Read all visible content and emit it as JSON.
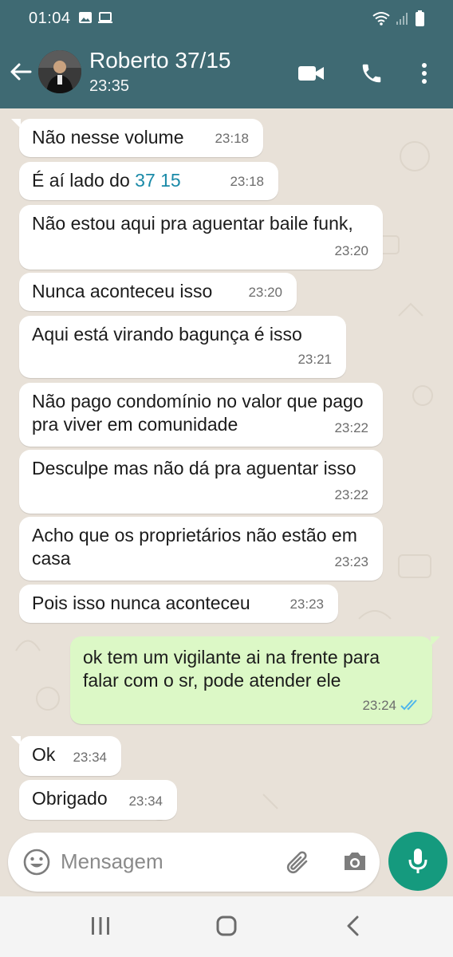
{
  "status_bar": {
    "time": "01:04"
  },
  "header": {
    "name": "Roberto 37/15",
    "status": "23:35"
  },
  "messages": [
    {
      "dir": "in",
      "text": "Não nesse volume",
      "time": "23:18"
    },
    {
      "dir": "in",
      "text_pre": "É aí lado do ",
      "text_link": "37 15",
      "time": "23:18"
    },
    {
      "dir": "in",
      "text": "Não  estou aqui pra aguentar baile funk,",
      "time": "23:20"
    },
    {
      "dir": "in",
      "text": "Nunca aconteceu isso",
      "time": "23:20"
    },
    {
      "dir": "in",
      "text": "Aqui está virando bagunça  é  isso",
      "time": "23:21"
    },
    {
      "dir": "in",
      "text": "Não pago condomínio no valor que pago pra viver em comunidade",
      "time": "23:22"
    },
    {
      "dir": "in",
      "text": "Desculpe mas não dá pra aguentar isso",
      "time": "23:22"
    },
    {
      "dir": "in",
      "text": "Acho que os proprietários não estão em casa",
      "time": "23:23"
    },
    {
      "dir": "in",
      "text": "Pois isso nunca aconteceu",
      "time": "23:23"
    },
    {
      "dir": "out",
      "text": "ok tem um vigilante ai na frente para falar com o sr, pode atender ele",
      "time": "23:24",
      "read": true
    },
    {
      "dir": "in",
      "text": "Ok",
      "time": "23:34"
    },
    {
      "dir": "in",
      "text": "Obrigado",
      "time": "23:34"
    }
  ],
  "composer": {
    "placeholder": "Mensagem"
  },
  "colors": {
    "header": "#3f6a73",
    "chat_bg": "#e8e1d8",
    "incoming": "#ffffff",
    "outgoing": "#dcf8c6",
    "accent": "#159a7e",
    "link": "#1a8aa8",
    "read_ticks": "#4fb6ec"
  }
}
